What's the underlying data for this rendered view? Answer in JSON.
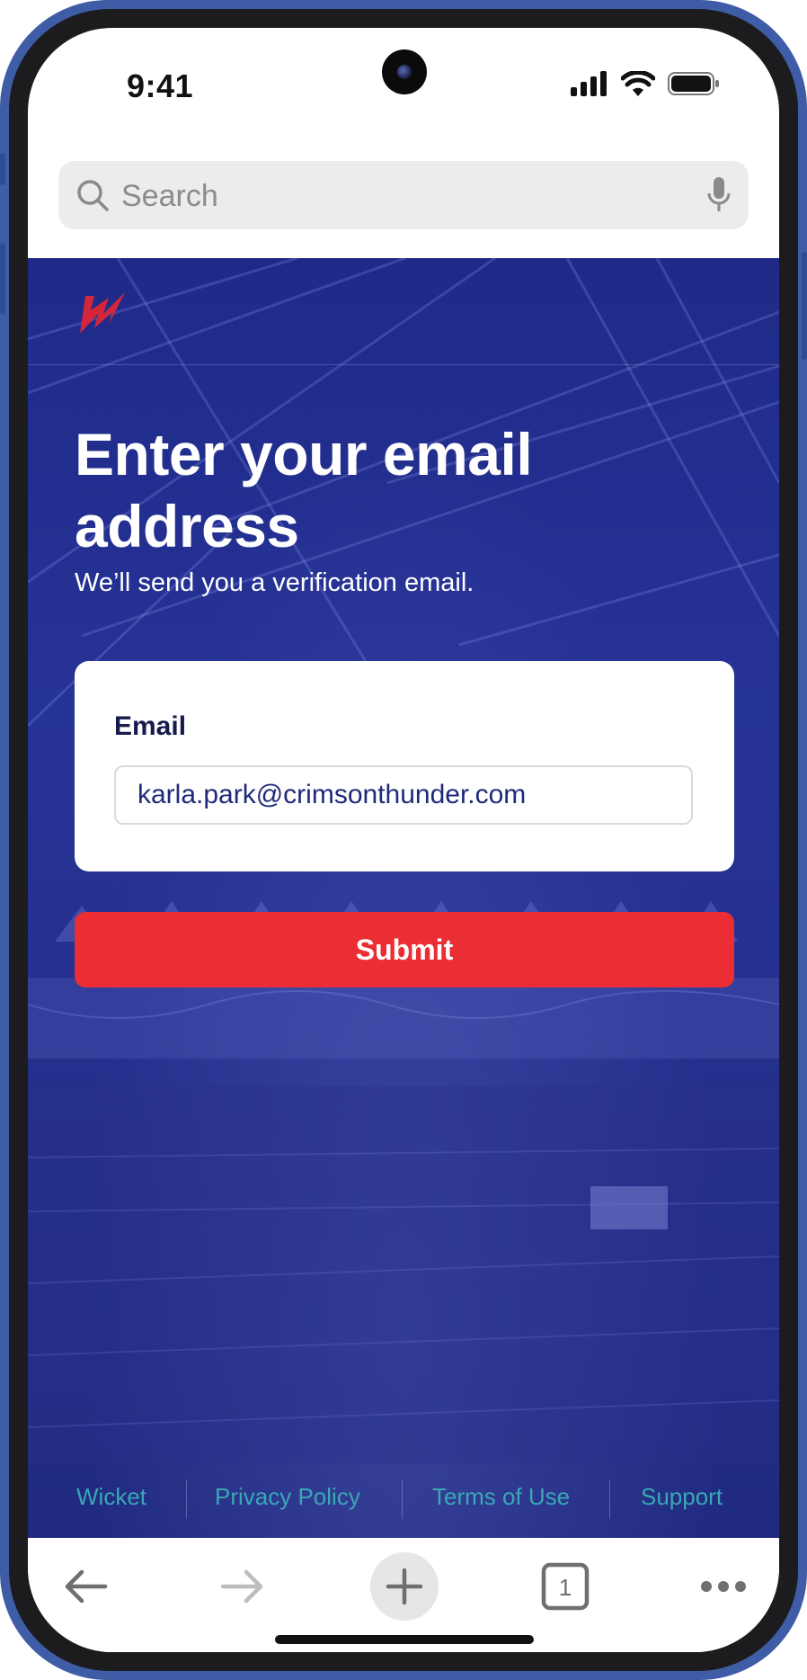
{
  "status_bar": {
    "time": "9:41"
  },
  "browser": {
    "search_placeholder": "Search"
  },
  "page": {
    "heading": "Enter your email address",
    "subheading": "We’ll send you a verification email.",
    "email_label": "Email",
    "email_value": "karla.park@crimsonthunder.com",
    "submit_label": "Submit",
    "footer_links": [
      "Wicket",
      "Privacy Policy",
      "Terms of Use",
      "Support"
    ]
  },
  "toolbar": {
    "tab_count": "1"
  },
  "colors": {
    "frame": "#3f5da6",
    "page_background": "#25308e",
    "brand_red": "#ea2e34",
    "footer_link": "#3aa7b3"
  }
}
